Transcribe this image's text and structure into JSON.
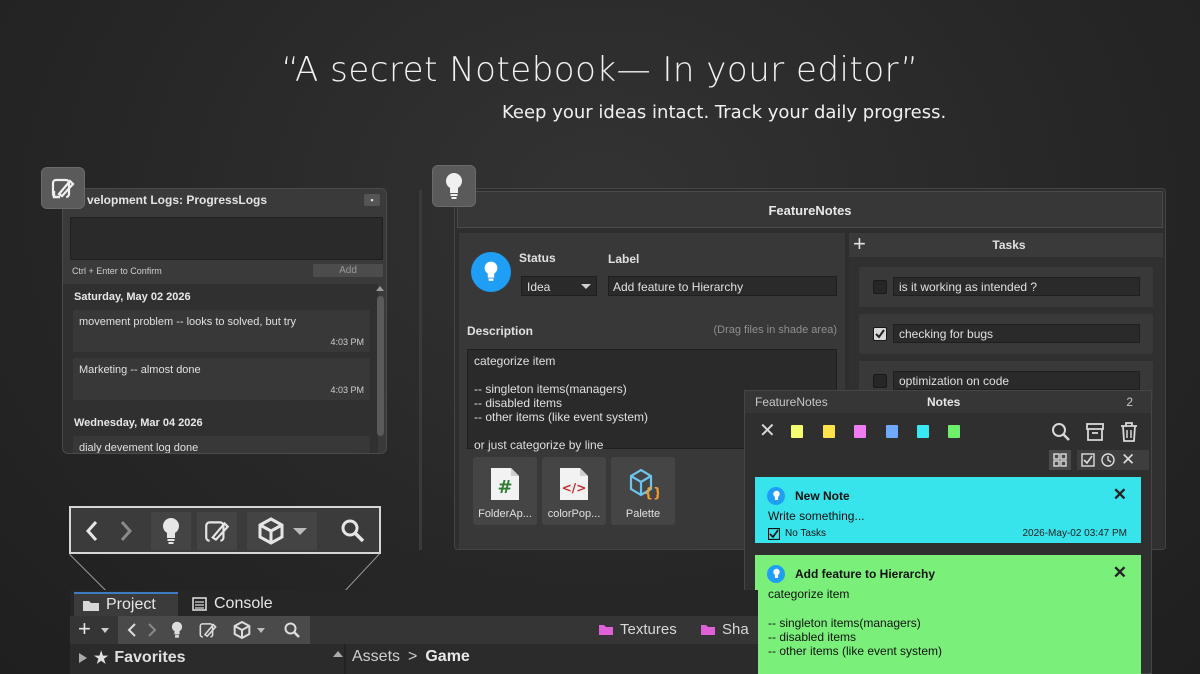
{
  "hero": {
    "headline": "“A secret Notebook— In your editor”",
    "subline": "Keep your ideas intact. Track your daily progress."
  },
  "devlog": {
    "title": "velopment Logs: ProgressLogs",
    "hint": "Ctrl + Enter to Confirm",
    "add_label": "Add",
    "groups": [
      {
        "date": "Saturday, May 02 2026",
        "entries": [
          {
            "text": "movement problem -- looks to solved, but try",
            "time": "4:03 PM"
          },
          {
            "text": "Marketing -- almost done",
            "time": "4:03 PM"
          }
        ]
      },
      {
        "date": "Wednesday, Mar 04 2026",
        "entries": [
          {
            "text": "dialy devement log done",
            "time": ""
          }
        ]
      }
    ]
  },
  "feature_notes": {
    "window_title": "FeatureNotes",
    "status_label": "Status",
    "status_value": "Idea",
    "label_label": "Label",
    "label_value": "Add feature to Hierarchy",
    "description_label": "Description",
    "description_hint": "(Drag files in shade area)",
    "description_lines": [
      "categorize item",
      "",
      "-- singleton items(managers)",
      "-- disabled items",
      "-- other items (like event system)",
      "",
      "or just categorize by line"
    ],
    "files": [
      {
        "name": "FolderAp...",
        "icon": "csharp-script-icon"
      },
      {
        "name": "colorPop...",
        "icon": "code-file-icon"
      },
      {
        "name": "Palette",
        "icon": "package-icon"
      }
    ],
    "tasks_title": "Tasks",
    "tasks": [
      {
        "text": "is it working as intended ?",
        "done": false
      },
      {
        "text": "checking for bugs",
        "done": true
      },
      {
        "text": "optimization on code",
        "done": false
      }
    ]
  },
  "notes_panel": {
    "left_label": "FeatureNotes",
    "title": "Notes",
    "count": "2",
    "colors": [
      "#f6ff6e",
      "#ffe24a",
      "#f07cf2",
      "#6fa8ff",
      "#38e8f4",
      "#6cf06c"
    ],
    "cards": [
      {
        "title": "New Note",
        "body": "Write something...",
        "tasks_label": "No Tasks",
        "timestamp": "2026-May-02 03:47 PM",
        "color": "#38e4ec"
      },
      {
        "title": "Add feature to Hierarchy",
        "body_lines": [
          "categorize item",
          "",
          "-- singleton items(managers)",
          "-- disabled items",
          "-- other items (like event system)"
        ],
        "color": "#7af07a"
      }
    ]
  },
  "project": {
    "tab_project": "Project",
    "tab_console": "Console",
    "textures": "Textures",
    "sha": "Sha",
    "favorites": "Favorites",
    "breadcrumb_root": "Assets",
    "breadcrumb_sep": ">",
    "breadcrumb_current": "Game"
  }
}
